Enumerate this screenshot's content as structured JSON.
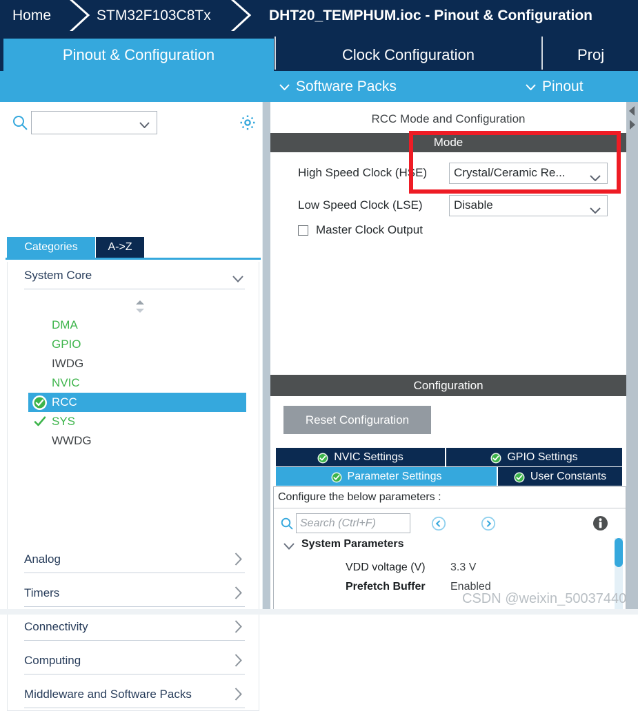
{
  "breadcrumb": {
    "home": "Home",
    "mcu": "STM32F103C8Tx",
    "file": "DHT20_TEMPHUM.ioc - Pinout & Configuration"
  },
  "tabs": [
    {
      "label": "Pinout & Configuration",
      "active": true
    },
    {
      "label": "Clock Configuration",
      "active": false
    },
    {
      "label": "Proj",
      "active": false
    }
  ],
  "subbar": {
    "software_packs": "Software Packs",
    "pinout": "Pinout"
  },
  "sidebar": {
    "search_value": "",
    "category_tabs": [
      {
        "label": "Categories",
        "active": true
      },
      {
        "label": "A->Z",
        "active": false
      }
    ],
    "groups": [
      {
        "label": "System Core",
        "expanded": true
      },
      {
        "label": "Analog",
        "expanded": false
      },
      {
        "label": "Timers",
        "expanded": false
      },
      {
        "label": "Connectivity",
        "expanded": false
      },
      {
        "label": "Computing",
        "expanded": false
      },
      {
        "label": "Middleware and Software Packs",
        "expanded": false
      }
    ],
    "peripherals": [
      {
        "label": "DMA",
        "state": "configurable",
        "selected": false
      },
      {
        "label": "GPIO",
        "state": "configurable",
        "selected": false
      },
      {
        "label": "IWDG",
        "state": "inactive",
        "selected": false
      },
      {
        "label": "NVIC",
        "state": "configurable",
        "selected": false
      },
      {
        "label": "RCC",
        "state": "configured",
        "selected": true
      },
      {
        "label": "SYS",
        "state": "checked",
        "selected": false
      },
      {
        "label": "WWDG",
        "state": "inactive",
        "selected": false
      }
    ]
  },
  "main": {
    "mode_title": "RCC Mode and Configuration",
    "mode_bar": "Mode",
    "fields": [
      {
        "label": "High Speed Clock (HSE)",
        "value": "Crystal/Ceramic Re..."
      },
      {
        "label": "Low Speed Clock (LSE)",
        "value": "Disable"
      }
    ],
    "checkbox": {
      "label": "Master Clock Output",
      "checked": false
    }
  },
  "configuration": {
    "bar_title": "Configuration",
    "reset_button": "Reset Configuration",
    "tabs_row1": [
      {
        "label": "NVIC Settings",
        "active": false
      },
      {
        "label": "GPIO Settings",
        "active": false
      }
    ],
    "tabs_row2": [
      {
        "label": "Parameter Settings",
        "active": true
      },
      {
        "label": "User Constants",
        "active": false
      }
    ],
    "instruction": "Configure the below parameters :",
    "search_placeholder": "Search (Ctrl+F)",
    "search_value": "",
    "tree_group": "System Parameters",
    "parameters": [
      {
        "name": "VDD voltage (V)",
        "value": "3.3 V"
      },
      {
        "name": "Prefetch Buffer",
        "value": "Enabled"
      }
    ]
  },
  "annotation": {
    "highlight_color": "#ee1c25"
  },
  "watermark": "CSDN @weixin_50037440",
  "colors": {
    "navy": "#0b2a51",
    "cyan": "#35a8dd",
    "dark_gray_bar": "#4d5051",
    "green": "#3cb44a",
    "red_highlight": "#ee1c25"
  }
}
